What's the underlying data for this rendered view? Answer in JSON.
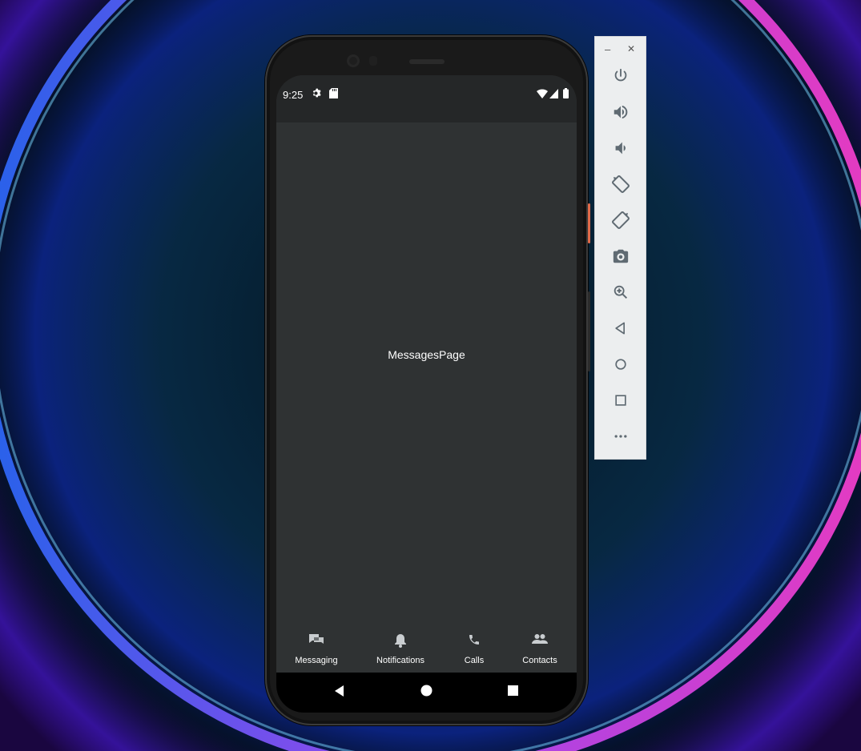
{
  "status_bar": {
    "time": "9:25"
  },
  "main": {
    "page_label": "MessagesPage"
  },
  "tabs": [
    {
      "label": "Messaging",
      "icon": "chat-bubbles-icon"
    },
    {
      "label": "Notifications",
      "icon": "bell-icon"
    },
    {
      "label": "Calls",
      "icon": "phone-icon"
    },
    {
      "label": "Contacts",
      "icon": "people-icon"
    }
  ],
  "emulator_toolbar": {
    "minimize": "–",
    "close": "✕",
    "buttons": [
      "power-icon",
      "volume-up-icon",
      "volume-down-icon",
      "rotate-left-icon",
      "rotate-right-icon",
      "camera-icon",
      "zoom-in-icon",
      "back-icon",
      "home-icon",
      "overview-icon",
      "more-icon"
    ]
  },
  "colors": {
    "screen_bg": "#2f3233",
    "status_bg": "#252728",
    "toolbar_bg": "#eceeef",
    "icon_gray": "#5f6a72"
  }
}
